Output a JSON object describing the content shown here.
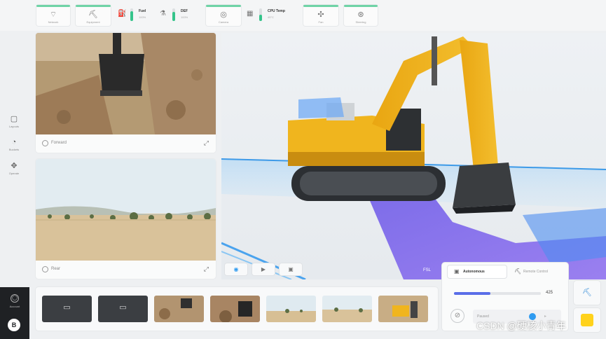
{
  "topbar": {
    "tiles": [
      {
        "icon": "wifi-icon",
        "glyph": "⌔",
        "caption": "Network"
      },
      {
        "icon": "excavator-icon",
        "glyph": "⛏",
        "caption": "Equipment"
      },
      {
        "icon": "camera-icon",
        "glyph": "◎",
        "caption": "Camera"
      },
      {
        "icon": "fan-icon",
        "glyph": "✣",
        "caption": "Fan"
      },
      {
        "icon": "steering-icon",
        "glyph": "⊛",
        "caption": "Steering"
      }
    ],
    "gauges": [
      {
        "icon": "fuel-icon",
        "glyph": "⛽",
        "label": "Fuel",
        "value": "100%",
        "level": 0.8
      },
      {
        "icon": "def-icon",
        "glyph": "⚗",
        "label": "DEF",
        "value": "100%",
        "level": 0.7
      },
      {
        "icon": "cpu-icon",
        "glyph": "▦",
        "label": "CPU Temp",
        "value": "45°C",
        "level": 0.5
      }
    ],
    "accent": "#6fd3a6"
  },
  "rail": {
    "items": [
      {
        "icon": "layouts-icon",
        "glyph": "▢",
        "label": "Layouts"
      },
      {
        "icon": "buckets-icon",
        "glyph": "◔",
        "label": "Buckets"
      },
      {
        "icon": "operate-icon",
        "glyph": "✥",
        "label": "Operate"
      }
    ],
    "account_label": "Account",
    "logo": "B"
  },
  "cameras": {
    "forward": {
      "label": "Forward"
    },
    "rear": {
      "label": "Rear"
    }
  },
  "view3d": {
    "controls": [
      {
        "icon": "target-icon",
        "glyph": "◉"
      },
      {
        "icon": "play-icon",
        "glyph": "▶"
      },
      {
        "icon": "save-icon",
        "glyph": "▣"
      }
    ]
  },
  "strip": {
    "thumbs": [
      {
        "kind": "placeholder",
        "icon": "monitor-icon",
        "glyph": "▭"
      },
      {
        "kind": "placeholder",
        "icon": "monitor-icon",
        "glyph": "▭"
      },
      {
        "kind": "image",
        "scene": "dig"
      },
      {
        "kind": "image",
        "scene": "bucket"
      },
      {
        "kind": "image",
        "scene": "field"
      },
      {
        "kind": "image",
        "scene": "field"
      },
      {
        "kind": "image",
        "scene": "machine"
      }
    ]
  },
  "control": {
    "tab_autonomous": "Autonomous",
    "tab_remote": "Remote Control",
    "speed_value": "425",
    "speed_fraction": 0.42,
    "paused_label": "Paused",
    "accent": "#5a6ee8"
  },
  "watermark": "CSDN @硬核小青年"
}
